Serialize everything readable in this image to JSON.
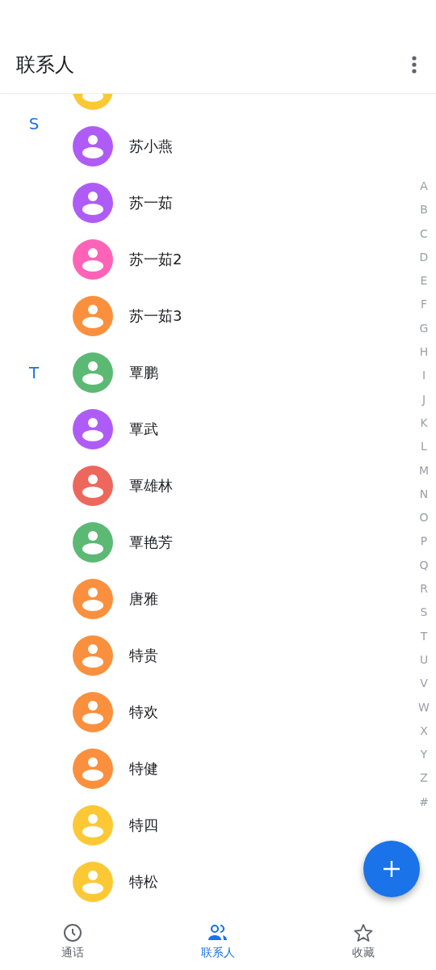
{
  "header": {
    "title": "联系人"
  },
  "partial_row": {
    "color": "#fcc934"
  },
  "contacts": [
    {
      "section": "S",
      "name": "苏小燕",
      "color": "#af5cf7"
    },
    {
      "name": "苏一茹",
      "color": "#af5cf7"
    },
    {
      "name": "苏一茹2",
      "color": "#ff63b8"
    },
    {
      "name": "苏一茹3",
      "color": "#fa903e"
    },
    {
      "section": "T",
      "name": "覃鹏",
      "color": "#5bb974"
    },
    {
      "name": "覃武",
      "color": "#af5cf7"
    },
    {
      "name": "覃雄林",
      "color": "#ee675c"
    },
    {
      "name": "覃艳芳",
      "color": "#5bb974"
    },
    {
      "name": "唐雅",
      "color": "#fa903e"
    },
    {
      "name": "特贵",
      "color": "#fa903e"
    },
    {
      "name": "特欢",
      "color": "#fa903e"
    },
    {
      "name": "特健",
      "color": "#fa903e"
    },
    {
      "name": "特四",
      "color": "#fcc934"
    },
    {
      "name": "特松",
      "color": "#fcc934"
    }
  ],
  "index": [
    "A",
    "B",
    "C",
    "D",
    "E",
    "F",
    "G",
    "H",
    "I",
    "J",
    "K",
    "L",
    "M",
    "N",
    "O",
    "P",
    "Q",
    "R",
    "S",
    "T",
    "U",
    "V",
    "W",
    "X",
    "Y",
    "Z",
    "#"
  ],
  "nav": [
    {
      "kind": "calls",
      "label": "通话",
      "selected": false
    },
    {
      "kind": "contacts",
      "label": "联系人",
      "selected": true
    },
    {
      "kind": "favorites",
      "label": "收藏",
      "selected": false
    }
  ]
}
